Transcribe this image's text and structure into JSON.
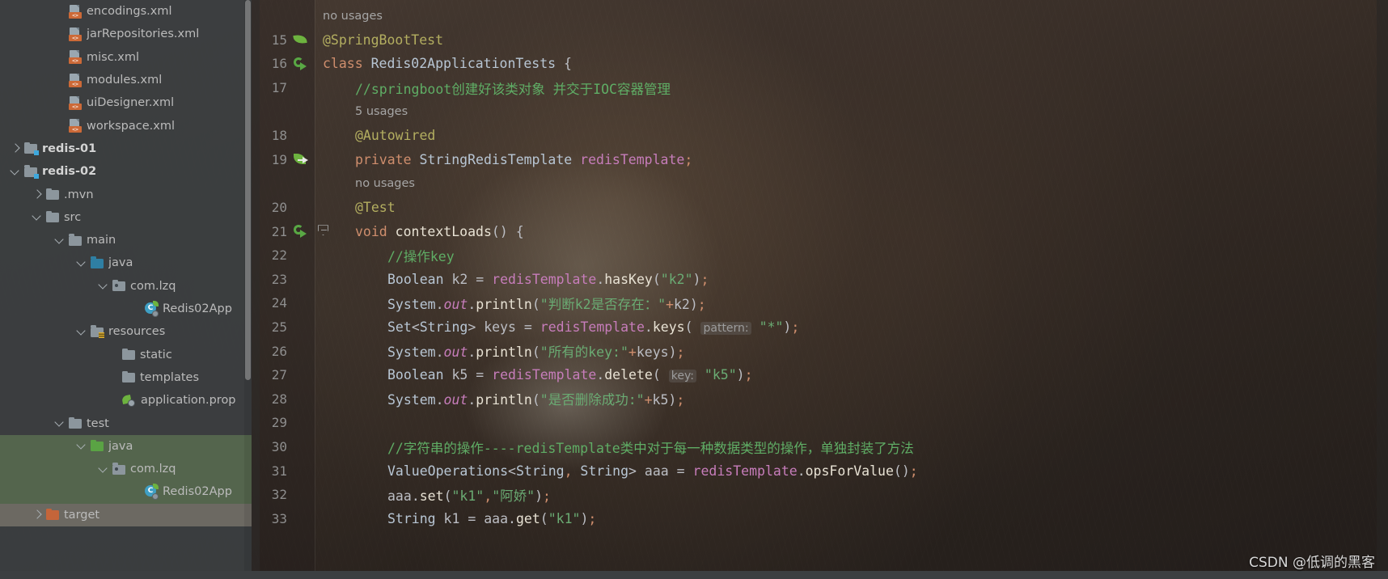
{
  "sidebar": {
    "items": [
      {
        "label": "encodings.xml",
        "icon": "xml-file-icon",
        "indent": 85,
        "arrow": "none",
        "bold": false,
        "row": "normal"
      },
      {
        "label": "jarRepositories.xml",
        "icon": "xml-file-icon",
        "indent": 85,
        "arrow": "none",
        "bold": false,
        "row": "normal"
      },
      {
        "label": "misc.xml",
        "icon": "xml-file-icon",
        "indent": 85,
        "arrow": "none",
        "bold": false,
        "row": "normal"
      },
      {
        "label": "modules.xml",
        "icon": "xml-file-icon",
        "indent": 85,
        "arrow": "none",
        "bold": false,
        "row": "normal"
      },
      {
        "label": "uiDesigner.xml",
        "icon": "xml-file-icon",
        "indent": 85,
        "arrow": "none",
        "bold": false,
        "row": "normal"
      },
      {
        "label": "workspace.xml",
        "icon": "xml-file-icon",
        "indent": 85,
        "arrow": "none",
        "bold": false,
        "row": "normal"
      },
      {
        "label": "redis-01",
        "icon": "module-folder-icon",
        "indent": 30,
        "arrow": "right",
        "bold": true,
        "row": "normal"
      },
      {
        "label": "redis-02",
        "icon": "module-folder-icon",
        "indent": 30,
        "arrow": "down",
        "bold": true,
        "row": "normal"
      },
      {
        "label": ".mvn",
        "icon": "folder-icon",
        "indent": 57,
        "arrow": "right",
        "bold": false,
        "row": "normal"
      },
      {
        "label": "src",
        "icon": "folder-icon",
        "indent": 57,
        "arrow": "down",
        "bold": false,
        "row": "normal"
      },
      {
        "label": "main",
        "icon": "folder-icon",
        "indent": 85,
        "arrow": "down",
        "bold": false,
        "row": "normal"
      },
      {
        "label": "java",
        "icon": "source-folder-blue-icon",
        "indent": 112,
        "arrow": "down",
        "bold": false,
        "row": "normal"
      },
      {
        "label": "com.lzq",
        "icon": "package-folder-icon",
        "indent": 139,
        "arrow": "down",
        "bold": false,
        "row": "normal"
      },
      {
        "label": "Redis02App",
        "icon": "spring-boot-class-icon",
        "indent": 178,
        "arrow": "none",
        "bold": false,
        "row": "normal"
      },
      {
        "label": "resources",
        "icon": "resources-folder-icon",
        "indent": 112,
        "arrow": "down",
        "bold": false,
        "row": "normal"
      },
      {
        "label": "static",
        "icon": "folder-icon",
        "indent": 151,
        "arrow": "none",
        "bold": false,
        "row": "normal"
      },
      {
        "label": "templates",
        "icon": "folder-icon",
        "indent": 151,
        "arrow": "none",
        "bold": false,
        "row": "normal"
      },
      {
        "label": "application.prop",
        "icon": "properties-file-icon",
        "indent": 151,
        "arrow": "none",
        "bold": false,
        "row": "normal"
      },
      {
        "label": "test",
        "icon": "folder-icon",
        "indent": 85,
        "arrow": "down",
        "bold": false,
        "row": "normal"
      },
      {
        "label": "java",
        "icon": "test-source-folder-green-icon",
        "indent": 112,
        "arrow": "down",
        "bold": false,
        "row": "selected"
      },
      {
        "label": "com.lzq",
        "icon": "package-folder-icon",
        "indent": 139,
        "arrow": "down",
        "bold": false,
        "row": "selected"
      },
      {
        "label": "Redis02App",
        "icon": "spring-boot-class-icon",
        "indent": 178,
        "arrow": "none",
        "bold": false,
        "row": "selected"
      },
      {
        "label": "target",
        "icon": "target-folder-orange-icon",
        "indent": 57,
        "arrow": "right",
        "bold": false,
        "row": "target"
      }
    ]
  },
  "editor": {
    "lines": [
      {
        "num": "",
        "gutter": "none",
        "fold": false,
        "indent": 0,
        "kind": "usages",
        "text": "no usages"
      },
      {
        "num": "15",
        "gutter": "spring-leaf",
        "fold": false,
        "indent": 0,
        "kind": "code",
        "tokens": [
          {
            "t": "@SpringBootTest",
            "c": "anno"
          }
        ]
      },
      {
        "num": "16",
        "gutter": "run-test",
        "fold": false,
        "indent": 0,
        "kind": "code",
        "tokens": [
          {
            "t": "class ",
            "c": "kw"
          },
          {
            "t": "Redis02ApplicationTests ",
            "c": "cls"
          },
          {
            "t": "{",
            "c": "punct"
          }
        ]
      },
      {
        "num": "17",
        "gutter": "none",
        "fold": false,
        "indent": 1,
        "kind": "code",
        "tokens": [
          {
            "t": "//springboot创建好该类对象 并交于IOC容器管理",
            "c": "comment"
          }
        ]
      },
      {
        "num": "",
        "gutter": "none",
        "fold": false,
        "indent": 1,
        "kind": "usages",
        "text": "5 usages"
      },
      {
        "num": "18",
        "gutter": "none",
        "fold": false,
        "indent": 1,
        "kind": "code",
        "tokens": [
          {
            "t": "@Autowired",
            "c": "anno"
          }
        ]
      },
      {
        "num": "19",
        "gutter": "bean-arrow",
        "fold": false,
        "indent": 1,
        "kind": "code",
        "tokens": [
          {
            "t": "private ",
            "c": "kw"
          },
          {
            "t": "StringRedisTemplate ",
            "c": "cls"
          },
          {
            "t": "redisTemplate",
            "c": "field"
          },
          {
            "t": ";",
            "c": "semi"
          }
        ]
      },
      {
        "num": "",
        "gutter": "none",
        "fold": false,
        "indent": 1,
        "kind": "usages",
        "text": "no usages"
      },
      {
        "num": "20",
        "gutter": "none",
        "fold": false,
        "indent": 1,
        "kind": "code",
        "tokens": [
          {
            "t": "@Test",
            "c": "anno"
          }
        ]
      },
      {
        "num": "21",
        "gutter": "run-test",
        "fold": true,
        "indent": 1,
        "kind": "code",
        "tokens": [
          {
            "t": "void ",
            "c": "kw"
          },
          {
            "t": "contextLoads",
            "c": "meth"
          },
          {
            "t": "() {",
            "c": "punct"
          }
        ]
      },
      {
        "num": "22",
        "gutter": "none",
        "fold": false,
        "indent": 2,
        "kind": "code",
        "tokens": [
          {
            "t": "//操作key",
            "c": "comment"
          }
        ]
      },
      {
        "num": "23",
        "gutter": "none",
        "fold": false,
        "indent": 2,
        "kind": "code",
        "tokens": [
          {
            "t": "Boolean ",
            "c": "cls"
          },
          {
            "t": "k2 ",
            "c": "plain"
          },
          {
            "t": "= ",
            "c": "punct"
          },
          {
            "t": "redisTemplate",
            "c": "field"
          },
          {
            "t": ".",
            "c": "punct"
          },
          {
            "t": "hasKey",
            "c": "meth"
          },
          {
            "t": "(",
            "c": "punct"
          },
          {
            "t": "\"k2\"",
            "c": "str"
          },
          {
            "t": ")",
            "c": "punct"
          },
          {
            "t": ";",
            "c": "semi"
          }
        ]
      },
      {
        "num": "24",
        "gutter": "none",
        "fold": false,
        "indent": 2,
        "kind": "code",
        "tokens": [
          {
            "t": "System",
            "c": "cls"
          },
          {
            "t": ".",
            "c": "punct"
          },
          {
            "t": "out",
            "c": "field italic"
          },
          {
            "t": ".",
            "c": "punct"
          },
          {
            "t": "println",
            "c": "meth"
          },
          {
            "t": "(",
            "c": "punct"
          },
          {
            "t": "\"判断k2是否存在：\"",
            "c": "str"
          },
          {
            "t": "+",
            "c": "kw"
          },
          {
            "t": "k2",
            "c": "plain"
          },
          {
            "t": ")",
            "c": "punct"
          },
          {
            "t": ";",
            "c": "semi"
          }
        ]
      },
      {
        "num": "25",
        "gutter": "none",
        "fold": false,
        "indent": 2,
        "kind": "code",
        "tokens": [
          {
            "t": "Set",
            "c": "cls"
          },
          {
            "t": "<",
            "c": "punct"
          },
          {
            "t": "String",
            "c": "cls"
          },
          {
            "t": "> ",
            "c": "punct"
          },
          {
            "t": "keys ",
            "c": "plain"
          },
          {
            "t": "= ",
            "c": "punct"
          },
          {
            "t": "redisTemplate",
            "c": "field"
          },
          {
            "t": ".",
            "c": "punct"
          },
          {
            "t": "keys",
            "c": "meth"
          },
          {
            "t": "( ",
            "c": "punct"
          },
          {
            "t": "pattern:",
            "c": "param-hint"
          },
          {
            "t": " \"*\"",
            "c": "str"
          },
          {
            "t": ")",
            "c": "punct"
          },
          {
            "t": ";",
            "c": "semi"
          }
        ]
      },
      {
        "num": "26",
        "gutter": "none",
        "fold": false,
        "indent": 2,
        "kind": "code",
        "tokens": [
          {
            "t": "System",
            "c": "cls"
          },
          {
            "t": ".",
            "c": "punct"
          },
          {
            "t": "out",
            "c": "field italic"
          },
          {
            "t": ".",
            "c": "punct"
          },
          {
            "t": "println",
            "c": "meth"
          },
          {
            "t": "(",
            "c": "punct"
          },
          {
            "t": "\"所有的key:\"",
            "c": "str"
          },
          {
            "t": "+",
            "c": "kw"
          },
          {
            "t": "keys",
            "c": "plain"
          },
          {
            "t": ")",
            "c": "punct"
          },
          {
            "t": ";",
            "c": "semi"
          }
        ]
      },
      {
        "num": "27",
        "gutter": "none",
        "fold": false,
        "indent": 2,
        "kind": "code",
        "tokens": [
          {
            "t": "Boolean ",
            "c": "cls"
          },
          {
            "t": "k5 ",
            "c": "plain"
          },
          {
            "t": "= ",
            "c": "punct"
          },
          {
            "t": "redisTemplate",
            "c": "field"
          },
          {
            "t": ".",
            "c": "punct"
          },
          {
            "t": "delete",
            "c": "meth"
          },
          {
            "t": "( ",
            "c": "punct"
          },
          {
            "t": "key:",
            "c": "param-hint"
          },
          {
            "t": " \"k5\"",
            "c": "str"
          },
          {
            "t": ")",
            "c": "punct"
          },
          {
            "t": ";",
            "c": "semi"
          }
        ]
      },
      {
        "num": "28",
        "gutter": "none",
        "fold": false,
        "indent": 2,
        "kind": "code",
        "tokens": [
          {
            "t": "System",
            "c": "cls"
          },
          {
            "t": ".",
            "c": "punct"
          },
          {
            "t": "out",
            "c": "field italic"
          },
          {
            "t": ".",
            "c": "punct"
          },
          {
            "t": "println",
            "c": "meth"
          },
          {
            "t": "(",
            "c": "punct"
          },
          {
            "t": "\"是否删除成功:\"",
            "c": "str"
          },
          {
            "t": "+",
            "c": "kw"
          },
          {
            "t": "k5",
            "c": "plain"
          },
          {
            "t": ")",
            "c": "punct"
          },
          {
            "t": ";",
            "c": "semi"
          }
        ]
      },
      {
        "num": "29",
        "gutter": "none",
        "fold": false,
        "indent": 2,
        "kind": "code",
        "tokens": []
      },
      {
        "num": "30",
        "gutter": "none",
        "fold": false,
        "indent": 2,
        "kind": "code",
        "tokens": [
          {
            "t": "//字符串的操作----redisTemplate类中对于每一种数据类型的操作，单独封装了方法",
            "c": "comment"
          }
        ]
      },
      {
        "num": "31",
        "gutter": "none",
        "fold": false,
        "indent": 2,
        "kind": "code",
        "tokens": [
          {
            "t": "ValueOperations",
            "c": "cls"
          },
          {
            "t": "<",
            "c": "punct"
          },
          {
            "t": "String",
            "c": "cls"
          },
          {
            "t": ",",
            "c": "semi"
          },
          {
            "t": " String",
            "c": "cls"
          },
          {
            "t": "> ",
            "c": "punct"
          },
          {
            "t": "aaa ",
            "c": "plain"
          },
          {
            "t": "= ",
            "c": "punct"
          },
          {
            "t": "redisTemplate",
            "c": "field"
          },
          {
            "t": ".",
            "c": "punct"
          },
          {
            "t": "opsForValue",
            "c": "meth"
          },
          {
            "t": "()",
            "c": "punct"
          },
          {
            "t": ";",
            "c": "semi"
          }
        ]
      },
      {
        "num": "32",
        "gutter": "none",
        "fold": false,
        "indent": 2,
        "kind": "code",
        "tokens": [
          {
            "t": "aaa",
            "c": "plain"
          },
          {
            "t": ".",
            "c": "punct"
          },
          {
            "t": "set",
            "c": "meth"
          },
          {
            "t": "(",
            "c": "punct"
          },
          {
            "t": "\"k1\"",
            "c": "str"
          },
          {
            "t": ",",
            "c": "semi"
          },
          {
            "t": "\"阿娇\"",
            "c": "str"
          },
          {
            "t": ")",
            "c": "punct"
          },
          {
            "t": ";",
            "c": "semi"
          }
        ]
      },
      {
        "num": "33",
        "gutter": "none",
        "fold": false,
        "indent": 2,
        "kind": "code",
        "tokens": [
          {
            "t": "String ",
            "c": "cls"
          },
          {
            "t": "k1 ",
            "c": "plain"
          },
          {
            "t": "= ",
            "c": "punct"
          },
          {
            "t": "aaa",
            "c": "plain"
          },
          {
            "t": ".",
            "c": "punct"
          },
          {
            "t": "get",
            "c": "meth"
          },
          {
            "t": "(",
            "c": "punct"
          },
          {
            "t": "\"k1\"",
            "c": "str"
          },
          {
            "t": ")",
            "c": "punct"
          },
          {
            "t": ";",
            "c": "semi"
          }
        ]
      }
    ]
  },
  "watermark": {
    "text": "CSDN @低调的黑客"
  },
  "colors": {
    "sidebar_bg": "#3c3f41",
    "selected_green": "#6a8759",
    "accent_orange": "#cc6937",
    "spring_green": "#6db33f",
    "comment_green": "#5fad65",
    "string_green": "#6aab73",
    "keyword_orange": "#cf8e6d",
    "field_purple": "#c77dbb",
    "annotation_yellow": "#b3ae60"
  }
}
